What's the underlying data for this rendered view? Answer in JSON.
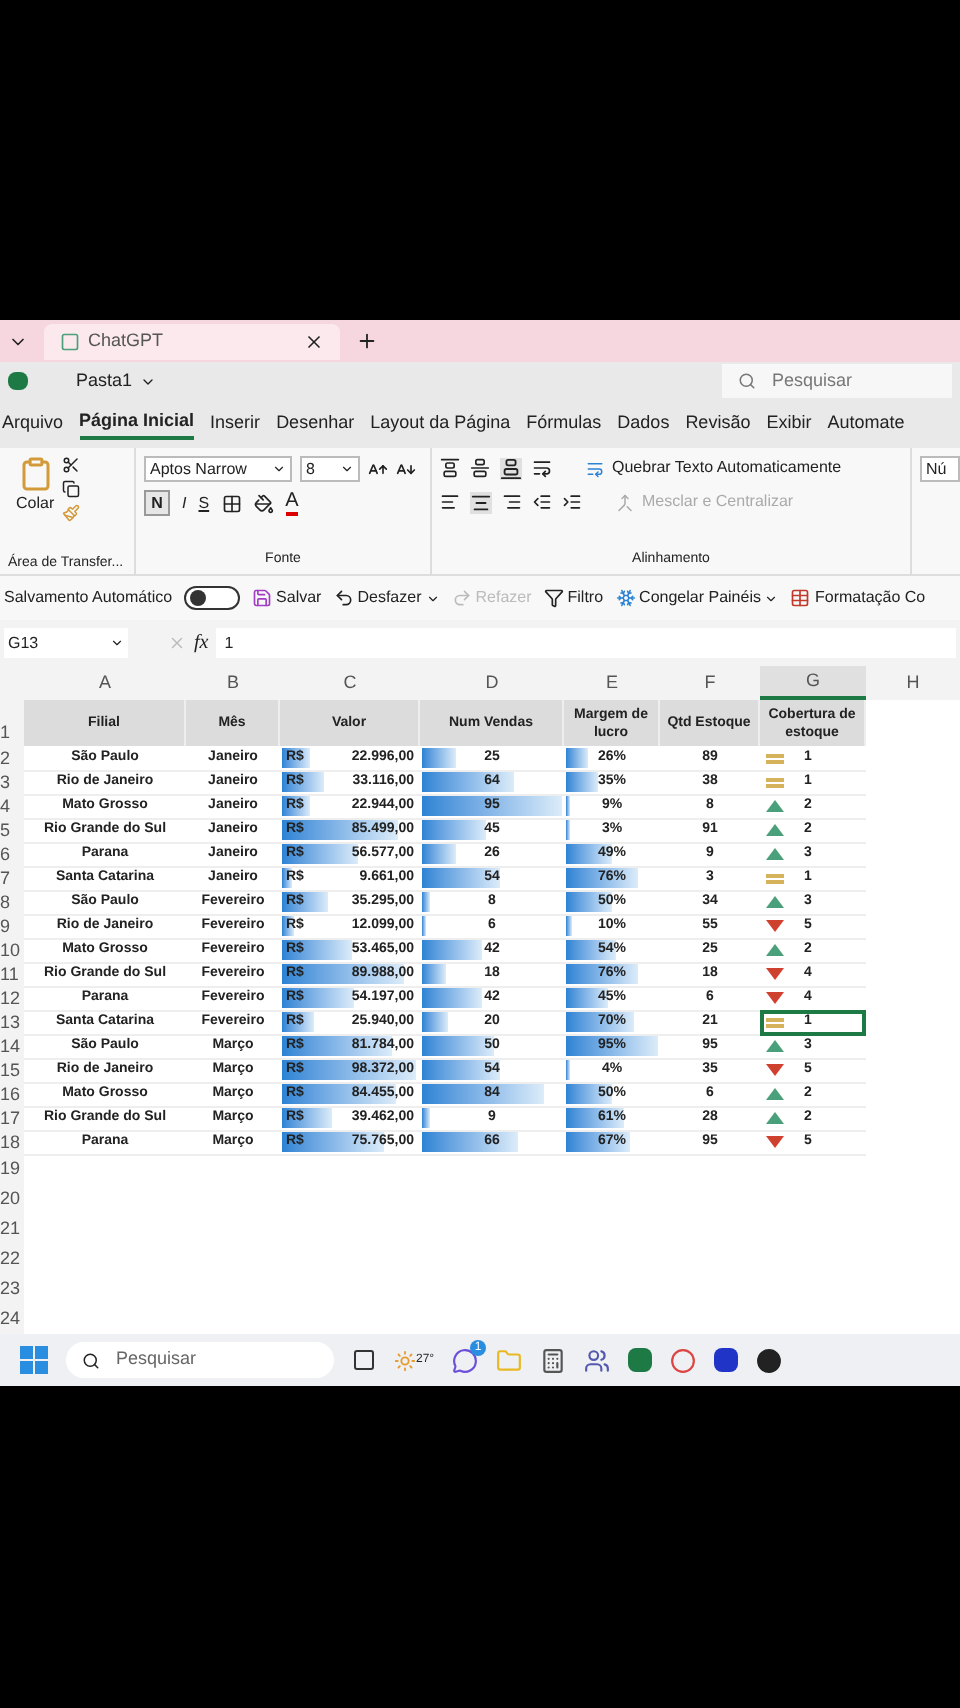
{
  "browser_tab": {
    "title": "ChatGPT"
  },
  "title_bar": {
    "workbook": "Pasta1",
    "search_placeholder": "Pesquisar"
  },
  "menu_tabs": [
    {
      "label": "Arquivo",
      "selected": false
    },
    {
      "label": "Página Inicial",
      "selected": true
    },
    {
      "label": "Inserir",
      "selected": false
    },
    {
      "label": "Desenhar",
      "selected": false
    },
    {
      "label": "Layout da Página",
      "selected": false
    },
    {
      "label": "Fórmulas",
      "selected": false
    },
    {
      "label": "Dados",
      "selected": false
    },
    {
      "label": "Revisão",
      "selected": false
    },
    {
      "label": "Exibir",
      "selected": false
    },
    {
      "label": "Automate",
      "selected": false
    }
  ],
  "ribbon": {
    "paste": "Colar",
    "clipboard_group": "Área de Transfer...",
    "font_name": "Aptos Narrow",
    "font_size": "8",
    "bold": "N",
    "italic": "I",
    "underline": "S",
    "font_color": "A",
    "font_group": "Fonte",
    "wrap_text": "Quebrar Texto Automaticamente",
    "merge": "Mesclar e Centralizar",
    "alignment_group": "Alinhamento",
    "number_format": "Nú"
  },
  "quick_access": {
    "autosave": "Salvamento Automático",
    "autosave_on": false,
    "save": "Salvar",
    "undo": "Desfazer",
    "redo": "Refazer",
    "filter": "Filtro",
    "freeze": "Congelar Painéis",
    "conditional": "Formatação Co"
  },
  "formula_bar": {
    "cell": "G13",
    "fx": "fx",
    "value": "1"
  },
  "columns": [
    "A",
    "B",
    "C",
    "D",
    "E",
    "F",
    "G",
    "H"
  ],
  "header": {
    "row": "1",
    "cells": [
      "Filial",
      "Mês",
      "Valor",
      "Num Vendas",
      "Margem de lucro",
      "Qtd Estoque",
      "Cobertura de estoque"
    ]
  },
  "rows": [
    {
      "row": "2",
      "filial": "São Paulo",
      "mes": "Janeiro",
      "currency": "R$",
      "valor": {
        "text": "22.996,00",
        "level": 0.23
      },
      "vendas": {
        "text": "25",
        "level": 0.26
      },
      "margem": {
        "text": "26%",
        "level": 0.27
      },
      "qtd": "89",
      "cobertura": {
        "kind": "flat",
        "text": "1"
      },
      "selected": false
    },
    {
      "row": "3",
      "filial": "Rio de Janeiro",
      "mes": "Janeiro",
      "currency": "R$",
      "valor": {
        "text": "33.116,00",
        "level": 0.33
      },
      "vendas": {
        "text": "64",
        "level": 0.67
      },
      "margem": {
        "text": "35%",
        "level": 0.37
      },
      "qtd": "38",
      "cobertura": {
        "kind": "flat",
        "text": "1"
      },
      "selected": false
    },
    {
      "row": "4",
      "filial": "Mato Grosso",
      "mes": "Janeiro",
      "currency": "R$",
      "valor": {
        "text": "22.944,00",
        "level": 0.23
      },
      "vendas": {
        "text": "95",
        "level": 1
      },
      "margem": {
        "text": "9%",
        "level": 0.09
      },
      "qtd": "8",
      "cobertura": {
        "kind": "up",
        "text": "2"
      },
      "selected": false
    },
    {
      "row": "5",
      "filial": "Rio Grande do Sul",
      "mes": "Janeiro",
      "currency": "R$",
      "valor": {
        "text": "85.499,00",
        "level": 0.85
      },
      "vendas": {
        "text": "45",
        "level": 0.47
      },
      "margem": {
        "text": "3%",
        "level": 0.03
      },
      "qtd": "91",
      "cobertura": {
        "kind": "up",
        "text": "2"
      },
      "selected": false
    },
    {
      "row": "6",
      "filial": "Parana",
      "mes": "Janeiro",
      "currency": "R$",
      "valor": {
        "text": "56.577,00",
        "level": 0.57
      },
      "vendas": {
        "text": "26",
        "level": 0.27
      },
      "margem": {
        "text": "49%",
        "level": 0.52
      },
      "qtd": "9",
      "cobertura": {
        "kind": "up",
        "text": "3"
      },
      "selected": false
    },
    {
      "row": "7",
      "filial": "Santa Catarina",
      "mes": "Janeiro",
      "currency": "R$",
      "valor": {
        "text": "9.661,00",
        "level": 0.1
      },
      "vendas": {
        "text": "54",
        "level": 0.57
      },
      "margem": {
        "text": "76%",
        "level": 0.8
      },
      "qtd": "3",
      "cobertura": {
        "kind": "flat",
        "text": "1"
      },
      "selected": false
    },
    {
      "row": "8",
      "filial": "São Paulo",
      "mes": "Fevereiro",
      "currency": "R$",
      "valor": {
        "text": "35.295,00",
        "level": 0.35
      },
      "vendas": {
        "text": "8",
        "level": 0.08
      },
      "margem": {
        "text": "50%",
        "level": 0.53
      },
      "qtd": "34",
      "cobertura": {
        "kind": "up",
        "text": "3"
      },
      "selected": false
    },
    {
      "row": "9",
      "filial": "Rio de Janeiro",
      "mes": "Fevereiro",
      "currency": "R$",
      "valor": {
        "text": "12.099,00",
        "level": 0.12
      },
      "vendas": {
        "text": "6",
        "level": 0.06
      },
      "margem": {
        "text": "10%",
        "level": 0.11
      },
      "qtd": "55",
      "cobertura": {
        "kind": "down",
        "text": "5"
      },
      "selected": false
    },
    {
      "row": "10",
      "filial": "Mato Grosso",
      "mes": "Fevereiro",
      "currency": "R$",
      "valor": {
        "text": "53.465,00",
        "level": 0.53
      },
      "vendas": {
        "text": "42",
        "level": 0.44
      },
      "margem": {
        "text": "54%",
        "level": 0.57
      },
      "qtd": "25",
      "cobertura": {
        "kind": "up",
        "text": "2"
      },
      "selected": false
    },
    {
      "row": "11",
      "filial": "Rio Grande do Sul",
      "mes": "Fevereiro",
      "currency": "R$",
      "valor": {
        "text": "89.988,00",
        "level": 0.9
      },
      "vendas": {
        "text": "18",
        "level": 0.19
      },
      "margem": {
        "text": "76%",
        "level": 0.8
      },
      "qtd": "18",
      "cobertura": {
        "kind": "down",
        "text": "4"
      },
      "selected": false
    },
    {
      "row": "12",
      "filial": "Parana",
      "mes": "Fevereiro",
      "currency": "R$",
      "valor": {
        "text": "54.197,00",
        "level": 0.54
      },
      "vendas": {
        "text": "42",
        "level": 0.44
      },
      "margem": {
        "text": "45%",
        "level": 0.47
      },
      "qtd": "6",
      "cobertura": {
        "kind": "down",
        "text": "4"
      },
      "selected": false
    },
    {
      "row": "13",
      "filial": "Santa Catarina",
      "mes": "Fevereiro",
      "currency": "R$",
      "valor": {
        "text": "25.940,00",
        "level": 0.26
      },
      "vendas": {
        "text": "20",
        "level": 0.21
      },
      "margem": {
        "text": "70%",
        "level": 0.74
      },
      "qtd": "21",
      "cobertura": {
        "kind": "flat",
        "text": "1"
      },
      "selected": true
    },
    {
      "row": "14",
      "filial": "São Paulo",
      "mes": "Março",
      "currency": "R$",
      "valor": {
        "text": "81.784,00",
        "level": 0.82
      },
      "vendas": {
        "text": "50",
        "level": 0.53
      },
      "margem": {
        "text": "95%",
        "level": 1
      },
      "qtd": "95",
      "cobertura": {
        "kind": "up",
        "text": "3"
      },
      "selected": false
    },
    {
      "row": "15",
      "filial": "Rio de Janeiro",
      "mes": "Março",
      "currency": "R$",
      "valor": {
        "text": "98.372,00",
        "level": 0.98
      },
      "vendas": {
        "text": "54",
        "level": 0.57
      },
      "margem": {
        "text": "4%",
        "level": 0.04
      },
      "qtd": "35",
      "cobertura": {
        "kind": "down",
        "text": "5"
      },
      "selected": false
    },
    {
      "row": "16",
      "filial": "Mato Grosso",
      "mes": "Março",
      "currency": "R$",
      "valor": {
        "text": "84.455,00",
        "level": 0.84
      },
      "vendas": {
        "text": "84",
        "level": 0.88
      },
      "margem": {
        "text": "50%",
        "level": 0.53
      },
      "qtd": "6",
      "cobertura": {
        "kind": "up",
        "text": "2"
      },
      "selected": false
    },
    {
      "row": "17",
      "filial": "Rio Grande do Sul",
      "mes": "Março",
      "currency": "R$",
      "valor": {
        "text": "39.462,00",
        "level": 0.39
      },
      "vendas": {
        "text": "9",
        "level": 0.09
      },
      "margem": {
        "text": "61%",
        "level": 0.64
      },
      "qtd": "28",
      "cobertura": {
        "kind": "up",
        "text": "2"
      },
      "selected": false
    },
    {
      "row": "18",
      "filial": "Parana",
      "mes": "Março",
      "currency": "R$",
      "valor": {
        "text": "75.765,00",
        "level": 0.76
      },
      "vendas": {
        "text": "66",
        "level": 0.69
      },
      "margem": {
        "text": "67%",
        "level": 0.71
      },
      "qtd": "95",
      "cobertura": {
        "kind": "down",
        "text": "5"
      },
      "selected": false
    }
  ],
  "empty_rows": [
    "19",
    "20",
    "21",
    "22",
    "23",
    "24"
  ],
  "taskbar": {
    "search_placeholder": "Pesquisar",
    "weather": "27°",
    "chat_badge": "1"
  }
}
